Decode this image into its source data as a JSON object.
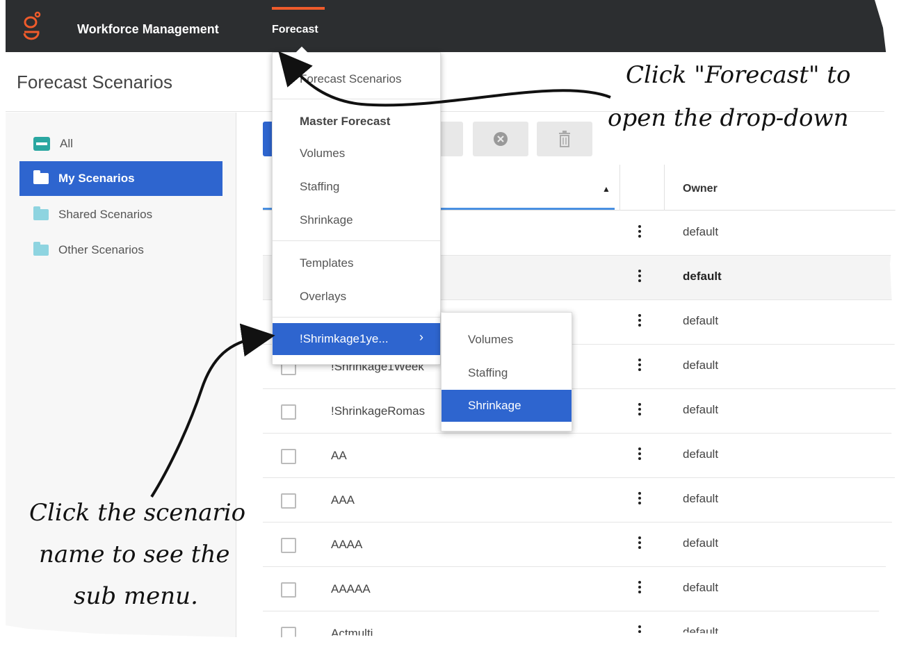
{
  "header": {
    "brand": "Workforce Management",
    "nav_forecast": "Forecast",
    "accent_color": "#ef5b2b"
  },
  "page": {
    "title": "Forecast Scenarios"
  },
  "sidebar": {
    "items": [
      {
        "label": "All",
        "icon": "all-icon"
      },
      {
        "label": "My Scenarios",
        "icon": "folder-icon",
        "active": true
      },
      {
        "label": "Shared Scenarios",
        "icon": "folder-icon"
      },
      {
        "label": "Other Scenarios",
        "icon": "folder-icon"
      }
    ]
  },
  "toolbar": {
    "cancel_icon": "close-circle-icon",
    "delete_icon": "trash-icon"
  },
  "table": {
    "owner_header": "Owner",
    "rows": [
      {
        "name": "",
        "owner": "default"
      },
      {
        "name": "",
        "owner": "default"
      },
      {
        "name": "",
        "owner": "default"
      },
      {
        "name": "!Shrinkage1Week",
        "owner": "default"
      },
      {
        "name": "!ShrinkageRomas",
        "owner": "default"
      },
      {
        "name": "AA",
        "owner": "default"
      },
      {
        "name": "AAA",
        "owner": "default"
      },
      {
        "name": "AAAA",
        "owner": "default"
      },
      {
        "name": "AAAAA",
        "owner": "default"
      },
      {
        "name": "Actmulti",
        "owner": "default"
      }
    ]
  },
  "dropdown": {
    "forecast_scenarios": "Forecast Scenarios",
    "master_forecast": "Master Forecast",
    "volumes": "Volumes",
    "staffing": "Staffing",
    "shrinkage": "Shrinkage",
    "templates": "Templates",
    "overlays": "Overlays",
    "scenario": "!Shrimkage1ye...",
    "chevron": "›"
  },
  "submenu": {
    "volumes": "Volumes",
    "staffing": "Staffing",
    "shrinkage": "Shrinkage"
  },
  "annotations": {
    "top_line1": "Click \"Forecast\" to",
    "top_line2": "open the drop-down",
    "bottom_line1": "Click the scenario",
    "bottom_line2": "name to see the",
    "bottom_line3": "sub menu."
  },
  "colors": {
    "topbar": "#2c2e30",
    "selection": "#2e65cf"
  }
}
